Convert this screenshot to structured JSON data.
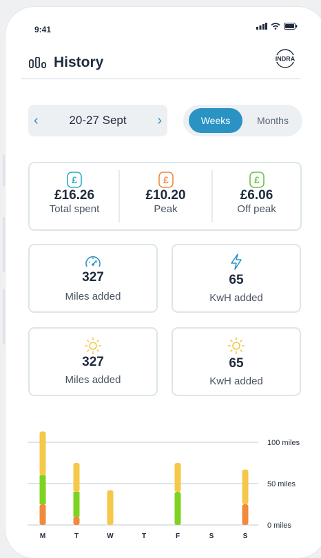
{
  "status_bar": {
    "time": "9:41"
  },
  "header": {
    "title": "History",
    "logo_text": "INDRA"
  },
  "date_nav": {
    "range": "20-27 Sept"
  },
  "period_toggle": {
    "weeks": "Weeks",
    "months": "Months",
    "selected": "Weeks"
  },
  "spend": [
    {
      "amount": "£16.26",
      "label": "Total spent",
      "icon": "pound-icon",
      "color": "#2ab0c9"
    },
    {
      "amount": "£10.20",
      "label": "Peak",
      "icon": "pound-icon",
      "color": "#f08a3c"
    },
    {
      "amount": "£6.06",
      "label": "Off peak",
      "icon": "pound-icon",
      "color": "#6cc04a"
    }
  ],
  "stats": [
    {
      "value": "327",
      "label": "Miles added",
      "icon": "speedometer-icon",
      "color": "#2a93c4"
    },
    {
      "value": "65",
      "label": "KwH added",
      "icon": "lightning-icon",
      "color": "#2a93c4"
    },
    {
      "value": "327",
      "label": "Miles added",
      "icon": "sun-icon",
      "color": "#f2c94c"
    },
    {
      "value": "65",
      "label": "KwH added",
      "icon": "sun-icon",
      "color": "#f2c94c"
    }
  ],
  "chart_data": {
    "type": "bar",
    "stacked": true,
    "categories": [
      "M",
      "T",
      "W",
      "T",
      "F",
      "S",
      "S"
    ],
    "y_tick_labels": [
      "100 miles",
      "50 miles",
      "0 miles"
    ],
    "y_ticks": [
      100,
      50,
      0
    ],
    "ylim": [
      0,
      110
    ],
    "series": [
      {
        "values": [
          25,
          10,
          0,
          0,
          0,
          0,
          25
        ],
        "color": "#f08a3c"
      },
      {
        "values": [
          35,
          30,
          0,
          0,
          40,
          0,
          0
        ],
        "color": "#7ed321"
      },
      {
        "values": [
          53,
          35,
          42,
          0,
          35,
          0,
          42
        ],
        "color": "#f5c84a"
      }
    ],
    "grid": true
  }
}
